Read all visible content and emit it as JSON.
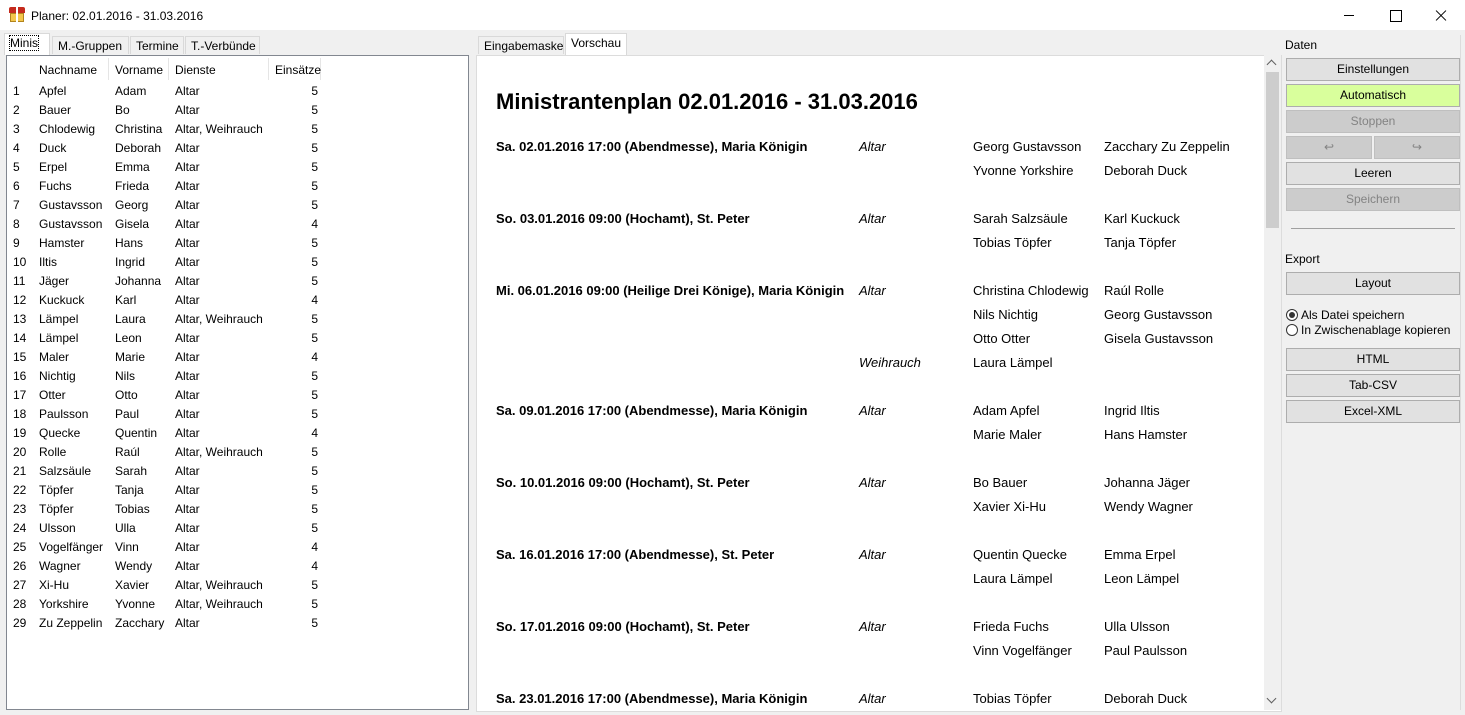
{
  "window": {
    "title": "Planer: 02.01.2016 - 31.03.2016"
  },
  "left_tabs": [
    "Minis",
    "M.-Gruppen",
    "Termine",
    "T.-Verbünde"
  ],
  "table": {
    "headers": [
      "Nachname",
      "Vorname",
      "Dienste",
      "Einsätze"
    ],
    "rows": [
      [
        "1",
        "Apfel",
        "Adam",
        "Altar",
        "5"
      ],
      [
        "2",
        "Bauer",
        "Bo",
        "Altar",
        "5"
      ],
      [
        "3",
        "Chlodewig",
        "Christina",
        "Altar, Weihrauch",
        "5"
      ],
      [
        "4",
        "Duck",
        "Deborah",
        "Altar",
        "5"
      ],
      [
        "5",
        "Erpel",
        "Emma",
        "Altar",
        "5"
      ],
      [
        "6",
        "Fuchs",
        "Frieda",
        "Altar",
        "5"
      ],
      [
        "7",
        "Gustavsson",
        "Georg",
        "Altar",
        "5"
      ],
      [
        "8",
        "Gustavsson",
        "Gisela",
        "Altar",
        "4"
      ],
      [
        "9",
        "Hamster",
        "Hans",
        "Altar",
        "5"
      ],
      [
        "10",
        "Iltis",
        "Ingrid",
        "Altar",
        "5"
      ],
      [
        "11",
        "Jäger",
        "Johanna",
        "Altar",
        "5"
      ],
      [
        "12",
        "Kuckuck",
        "Karl",
        "Altar",
        "4"
      ],
      [
        "13",
        "Lämpel",
        "Laura",
        "Altar, Weihrauch",
        "5"
      ],
      [
        "14",
        "Lämpel",
        "Leon",
        "Altar",
        "5"
      ],
      [
        "15",
        "Maler",
        "Marie",
        "Altar",
        "4"
      ],
      [
        "16",
        "Nichtig",
        "Nils",
        "Altar",
        "5"
      ],
      [
        "17",
        "Otter",
        "Otto",
        "Altar",
        "5"
      ],
      [
        "18",
        "Paulsson",
        "Paul",
        "Altar",
        "5"
      ],
      [
        "19",
        "Quecke",
        "Quentin",
        "Altar",
        "4"
      ],
      [
        "20",
        "Rolle",
        "Raúl",
        "Altar, Weihrauch",
        "5"
      ],
      [
        "21",
        "Salzsäule",
        "Sarah",
        "Altar",
        "5"
      ],
      [
        "22",
        "Töpfer",
        "Tanja",
        "Altar",
        "5"
      ],
      [
        "23",
        "Töpfer",
        "Tobias",
        "Altar",
        "5"
      ],
      [
        "24",
        "Ulsson",
        "Ulla",
        "Altar",
        "5"
      ],
      [
        "25",
        "Vogelfänger",
        "Vinn",
        "Altar",
        "4"
      ],
      [
        "26",
        "Wagner",
        "Wendy",
        "Altar",
        "4"
      ],
      [
        "27",
        "Xi-Hu",
        "Xavier",
        "Altar, Weihrauch",
        "5"
      ],
      [
        "28",
        "Yorkshire",
        "Yvonne",
        "Altar, Weihrauch",
        "5"
      ],
      [
        "29",
        "Zu Zeppelin",
        "Zacchary",
        "Altar",
        "5"
      ]
    ]
  },
  "mid_tabs": [
    "Eingabemaske",
    "Vorschau"
  ],
  "preview": {
    "title": "Ministrantenplan 02.01.2016 - 31.03.2016",
    "events": [
      {
        "head": "Sa. 02.01.2016 17:00 (Abendmesse), Maria Königin",
        "role": "Altar",
        "lines": [
          [
            "Georg Gustavsson",
            "Zacchary Zu Zeppelin"
          ],
          [
            "Yvonne Yorkshire",
            "Deborah Duck"
          ]
        ]
      },
      {
        "head": "So. 03.01.2016 09:00 (Hochamt), St. Peter",
        "role": "Altar",
        "lines": [
          [
            "Sarah Salzsäule",
            "Karl Kuckuck"
          ],
          [
            "Tobias Töpfer",
            "Tanja Töpfer"
          ]
        ]
      },
      {
        "head": "Mi. 06.01.2016 09:00 (Heilige Drei Könige), Maria Königin",
        "role": "Altar",
        "lines": [
          [
            "Christina Chlodewig",
            "Raúl Rolle"
          ],
          [
            "Nils Nichtig",
            "Georg Gustavsson"
          ],
          [
            "Otto Otter",
            "Gisela Gustavsson"
          ]
        ],
        "role2": "Weihrauch",
        "lines2": [
          [
            "Laura Lämpel",
            ""
          ]
        ]
      },
      {
        "head": "Sa. 09.01.2016 17:00 (Abendmesse), Maria Königin",
        "role": "Altar",
        "lines": [
          [
            "Adam Apfel",
            "Ingrid Iltis"
          ],
          [
            "Marie Maler",
            "Hans Hamster"
          ]
        ]
      },
      {
        "head": "So. 10.01.2016 09:00 (Hochamt), St. Peter",
        "role": "Altar",
        "lines": [
          [
            "Bo Bauer",
            "Johanna Jäger"
          ],
          [
            "Xavier Xi-Hu",
            "Wendy Wagner"
          ]
        ]
      },
      {
        "head": "Sa. 16.01.2016 17:00 (Abendmesse), St. Peter",
        "role": "Altar",
        "lines": [
          [
            "Quentin Quecke",
            "Emma Erpel"
          ],
          [
            "Laura Lämpel",
            "Leon Lämpel"
          ]
        ]
      },
      {
        "head": "So. 17.01.2016 09:00 (Hochamt), St. Peter",
        "role": "Altar",
        "lines": [
          [
            "Frieda Fuchs",
            "Ulla Ulsson"
          ],
          [
            "Vinn Vogelfänger",
            "Paul Paulsson"
          ]
        ]
      },
      {
        "head": "Sa. 23.01.2016 17:00 (Abendmesse), Maria Königin",
        "role": "Altar",
        "lines": [
          [
            "Tobias Töpfer",
            "Deborah Duck"
          ]
        ]
      }
    ]
  },
  "sidebar": {
    "daten_label": "Daten",
    "einstellungen": "Einstellungen",
    "automatisch": "Automatisch",
    "stoppen": "Stoppen",
    "undo": "↩",
    "redo": "↪",
    "leeren": "Leeren",
    "speichern": "Speichern",
    "export_label": "Export",
    "layout": "Layout",
    "radio_file": "Als Datei speichern",
    "radio_clipboard": "In Zwischenablage kopieren",
    "html": "HTML",
    "tab_csv": "Tab-CSV",
    "excel_xml": "Excel-XML"
  },
  "colors": {
    "automatisch_bg": "#d9ff9c",
    "disabled_bg": "#cccccc"
  }
}
